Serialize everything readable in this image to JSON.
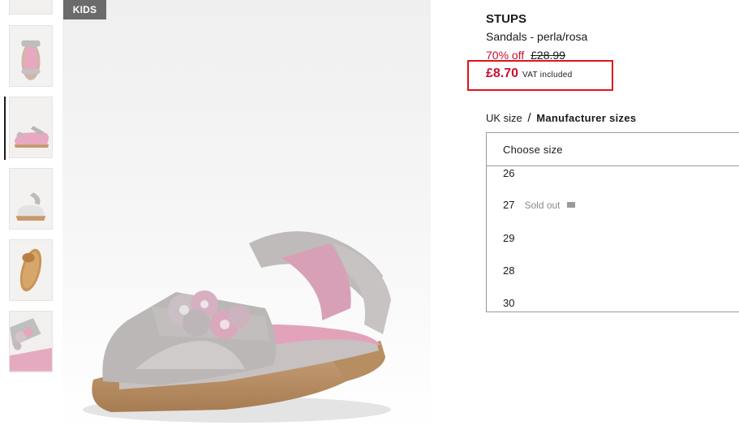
{
  "badge": "KIDS",
  "product": {
    "brand": "STUPS",
    "name": "Sandals - perla/rosa",
    "discount": "70% off",
    "old_price": "£28.99",
    "price": "£8.70",
    "vat": "VAT included"
  },
  "sizes": {
    "uk_label": "UK size",
    "separator": "/",
    "manufacturer_label": "Manufacturer sizes",
    "placeholder": "Choose size",
    "options": [
      {
        "size": "26",
        "status": ""
      },
      {
        "size": "27",
        "status": "Sold out"
      },
      {
        "size": "29",
        "status": ""
      },
      {
        "size": "28",
        "status": ""
      },
      {
        "size": "30",
        "status": ""
      }
    ]
  },
  "thumbnails": [
    "sandal-top-view",
    "sandal-side-view",
    "sandal-inner-view",
    "sandal-sole-view",
    "sandal-closeup-view"
  ],
  "colors": {
    "sale_red": "#c8102e",
    "highlight_border": "#e0151b",
    "badge_bg": "#6b6b6b"
  }
}
